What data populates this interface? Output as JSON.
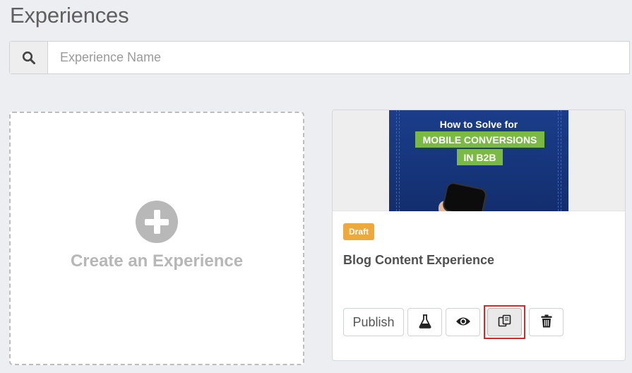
{
  "page": {
    "title": "Experiences"
  },
  "search": {
    "placeholder": "Experience Name",
    "value": ""
  },
  "create_card": {
    "label": "Create an Experience"
  },
  "experiences": [
    {
      "thumbnail": {
        "title": "How to Solve for",
        "tag_line1": "MOBILE CONVERSIONS",
        "tag_line2": "IN B2B"
      },
      "status": "Draft",
      "name": "Blog Content Experience",
      "actions": {
        "publish_label": "Publish",
        "test_icon": "flask-icon",
        "preview_icon": "eye-icon",
        "duplicate_icon": "copy-icon",
        "delete_icon": "trash-icon"
      }
    }
  ],
  "colors": {
    "background": "#eceef2",
    "draft_badge": "#eda93c",
    "highlight_border": "#d9262a",
    "thumbnail_green": "#79b944",
    "thumbnail_blue": "#1b3d8a"
  }
}
